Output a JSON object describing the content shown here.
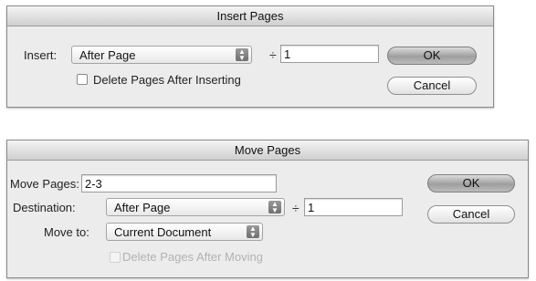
{
  "insert_pages": {
    "title": "Insert Pages",
    "insert_label": "Insert:",
    "insert_select": "After Page",
    "page_number": "1",
    "delete_after_label": "Delete Pages After Inserting",
    "ok_label": "OK",
    "cancel_label": "Cancel"
  },
  "move_pages": {
    "title": "Move Pages",
    "move_pages_label": "Move Pages:",
    "move_pages_value": "2-3",
    "destination_label": "Destination:",
    "destination_select": "After Page",
    "page_number": "1",
    "move_to_label": "Move to:",
    "move_to_select": "Current Document",
    "delete_after_label": "Delete Pages After Moving",
    "ok_label": "OK",
    "cancel_label": "Cancel"
  }
}
